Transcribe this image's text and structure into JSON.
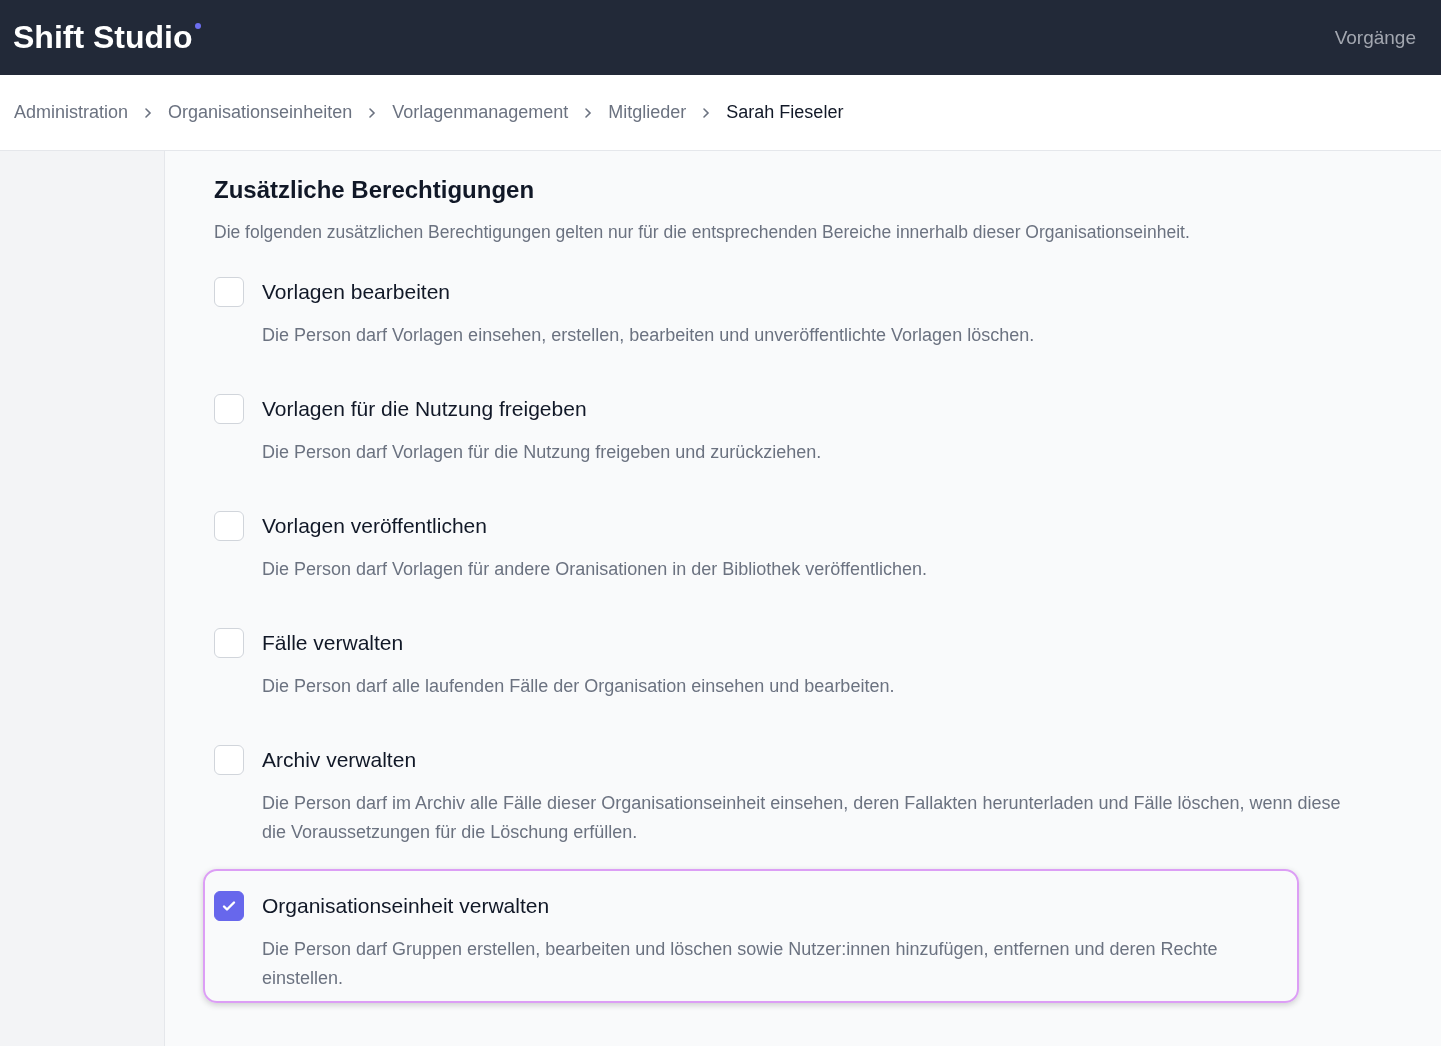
{
  "header": {
    "logo": "Shift Studio",
    "nav_link": "Vorgänge"
  },
  "breadcrumb": [
    {
      "label": "Administration",
      "current": false
    },
    {
      "label": "Organisationseinheiten",
      "current": false
    },
    {
      "label": "Vorlagenmanagement",
      "current": false
    },
    {
      "label": "Mitglieder",
      "current": false
    },
    {
      "label": "Sarah Fieseler",
      "current": true
    }
  ],
  "section": {
    "title": "Zusätzliche Berechtigungen",
    "description": "Die folgenden zusätzlichen Berechtigungen gelten nur für die entsprechenden Bereiche innerhalb dieser Organisationseinheit."
  },
  "permissions": [
    {
      "label": "Vorlagen bearbeiten",
      "description": "Die Person darf Vorlagen einsehen, erstellen, bearbeiten und unveröffentlichte Vorlagen löschen.",
      "checked": false,
      "focused": false
    },
    {
      "label": "Vorlagen für die Nutzung freigeben",
      "description": "Die Person darf Vorlagen für die Nutzung freigeben und zurückziehen.",
      "checked": false,
      "focused": false
    },
    {
      "label": "Vorlagen veröffentlichen",
      "description": "Die Person darf Vorlagen für andere Oranisationen in der Bibliothek veröffentlichen.",
      "checked": false,
      "focused": false
    },
    {
      "label": "Fälle verwalten",
      "description": "Die Person darf alle laufenden Fälle der Organisation einsehen und bearbeiten.",
      "checked": false,
      "focused": false
    },
    {
      "label": "Archiv verwalten",
      "description": "Die Person darf im Archiv alle Fälle dieser Organisationseinheit einsehen, deren Fallakten herunterladen und Fälle löschen, wenn diese die Voraussetzungen für die Löschung erfüllen.",
      "checked": false,
      "focused": false
    },
    {
      "label": "Organisationseinheit verwalten",
      "description": "Die Person darf Gruppen erstellen, bearbeiten und löschen sowie Nutzer:innen hinzufügen, entfernen und deren Rechte einstellen.",
      "checked": true,
      "focused": true
    }
  ]
}
